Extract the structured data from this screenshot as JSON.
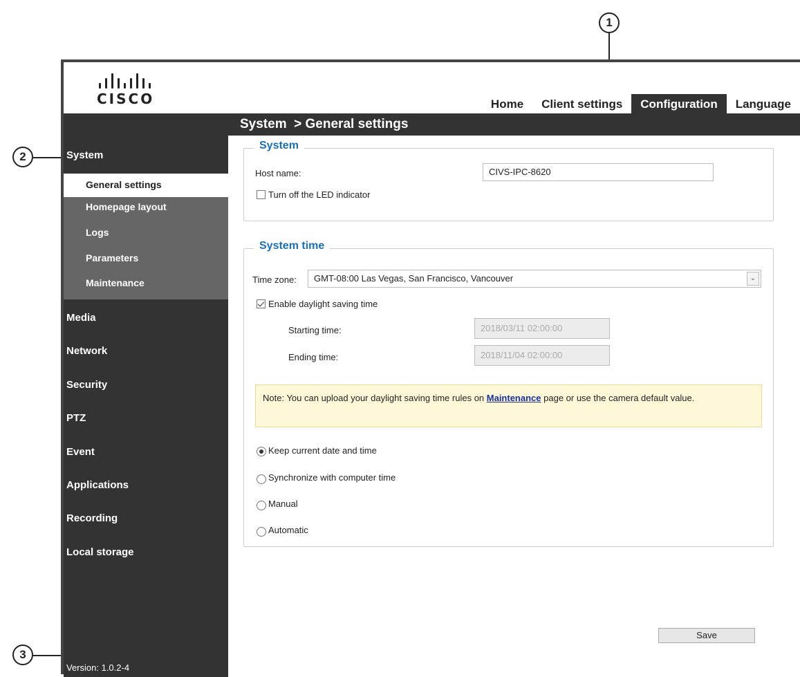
{
  "callouts": {
    "one": "1",
    "two": "2",
    "three": "3"
  },
  "header": {
    "logo_text": "CISCO",
    "nav": [
      {
        "label": "Home",
        "active": false
      },
      {
        "label": "Client settings",
        "active": false
      },
      {
        "label": "Configuration",
        "active": true
      },
      {
        "label": "Language",
        "active": false
      }
    ]
  },
  "breadcrumb": "System  > General settings",
  "sidebar": {
    "sections": [
      "System",
      "Media",
      "Network",
      "Security",
      "PTZ",
      "Event",
      "Applications",
      "Recording",
      "Local storage"
    ],
    "system_subitems": [
      "General settings",
      "Homepage layout",
      "Logs",
      "Parameters",
      "Maintenance"
    ],
    "active_subitem": "General settings",
    "version": "Version: 1.0.2-4"
  },
  "system_group": {
    "legend": "System",
    "host_name_label": "Host name:",
    "host_name_value": "CIVS-IPC-8620",
    "led_label": "Turn off the LED indicator",
    "led_checked": false
  },
  "time_group": {
    "legend": "System time",
    "time_zone_label": "Time zone:",
    "time_zone_value": "GMT-08:00 Las Vegas, San Francisco, Vancouver",
    "dst_label": "Enable daylight saving time",
    "dst_checked": true,
    "starting_label": "Starting time:",
    "starting_value": "2018/03/11 02:00:00",
    "ending_label": "Ending time:",
    "ending_value": "2018/11/04 02:00:00",
    "note_prefix": "Note: You can upload your daylight saving time rules on ",
    "note_link": "Maintenance",
    "note_suffix": " page or use the camera default value.",
    "options": [
      {
        "label": "Keep current date and time",
        "checked": true
      },
      {
        "label": "Synchronize with computer time",
        "checked": false
      },
      {
        "label": "Manual",
        "checked": false
      },
      {
        "label": "Automatic",
        "checked": false
      }
    ]
  },
  "save_label": "Save",
  "colors": {
    "dark": "#333333",
    "submenu": "#666666",
    "legend": "#1a6fb8",
    "note_bg": "#fdf8d8"
  }
}
